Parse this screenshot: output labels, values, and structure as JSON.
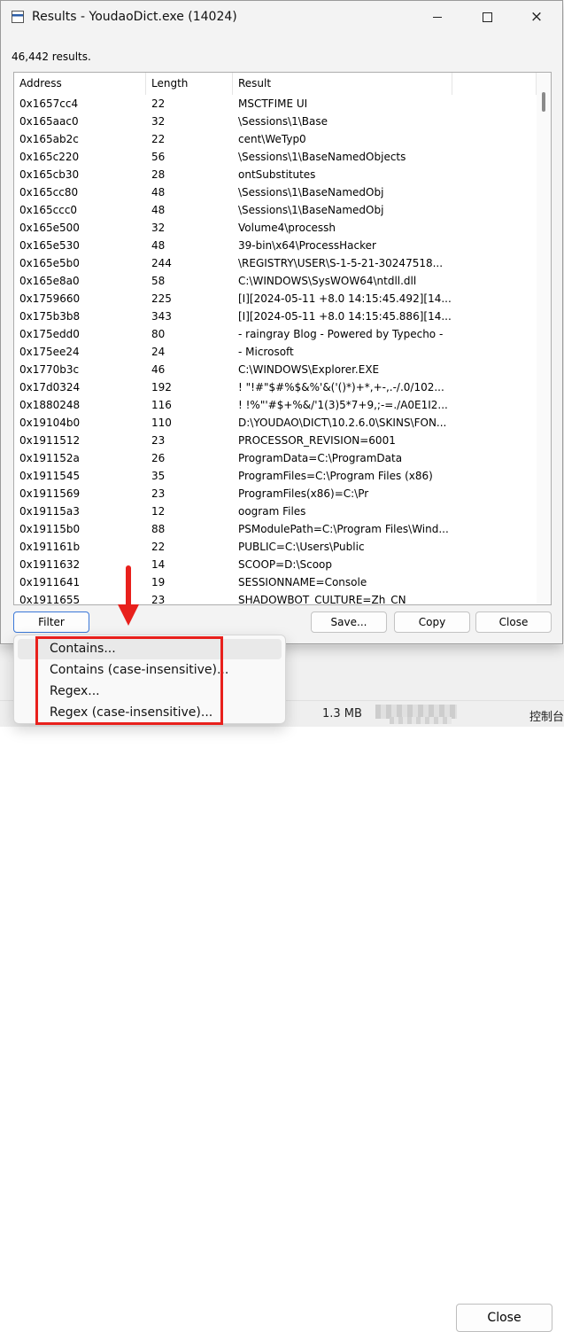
{
  "window": {
    "title": "Results - YoudaoDict.exe (14024)",
    "controls": {
      "minimize": "minimize",
      "maximize": "maximize",
      "close": "×"
    }
  },
  "results_count": "46,442 results.",
  "table": {
    "columns": [
      "Address",
      "Length",
      "Result"
    ],
    "rows": [
      [
        "0x1657cc4",
        "22",
        "MSCTFIME UI"
      ],
      [
        "0x165aac0",
        "32",
        "\\Sessions\\1\\Base"
      ],
      [
        "0x165ab2c",
        "22",
        "cent\\WeTyp0"
      ],
      [
        "0x165c220",
        "56",
        "\\Sessions\\1\\BaseNamedObjects"
      ],
      [
        "0x165cb30",
        "28",
        "ontSubstitutes"
      ],
      [
        "0x165cc80",
        "48",
        "\\Sessions\\1\\BaseNamedObj"
      ],
      [
        "0x165ccc0",
        "48",
        "\\Sessions\\1\\BaseNamedObj"
      ],
      [
        "0x165e500",
        "32",
        "Volume4\\processh"
      ],
      [
        "0x165e530",
        "48",
        "39-bin\\x64\\ProcessHacker"
      ],
      [
        "0x165e5b0",
        "244",
        "\\REGISTRY\\USER\\S-1-5-21-30247518..."
      ],
      [
        "0x165e8a0",
        "58",
        "C:\\WINDOWS\\SysWOW64\\ntdll.dll"
      ],
      [
        "0x1759660",
        "225",
        "[I][2024-05-11 +8.0 14:15:45.492][14..."
      ],
      [
        "0x175b3b8",
        "343",
        "[I][2024-05-11 +8.0 14:15:45.886][14..."
      ],
      [
        "0x175edd0",
        "80",
        " - raingray Blog - Powered by Typecho -"
      ],
      [
        "0x175ee24",
        "24",
        " - Microsoft"
      ],
      [
        "0x1770b3c",
        "46",
        "C:\\WINDOWS\\Explorer.EXE"
      ],
      [
        "0x17d0324",
        "192",
        "! \"!#\"$#%$&%'&('()*)+*,+-,.-/.0/102..."
      ],
      [
        "0x1880248",
        "116",
        "! !%\"'#$+%&/'1(3)5*7+9,;-=./A0E1I2..."
      ],
      [
        "0x19104b0",
        "110",
        "D:\\YOUDAO\\DICT\\10.2.6.0\\SKINS\\FON..."
      ],
      [
        "0x1911512",
        "23",
        "PROCESSOR_REVISION=6001"
      ],
      [
        "0x191152a",
        "26",
        "ProgramData=C:\\ProgramData"
      ],
      [
        "0x1911545",
        "35",
        "ProgramFiles=C:\\Program Files (x86)"
      ],
      [
        "0x1911569",
        "23",
        "ProgramFiles(x86)=C:\\Pr"
      ],
      [
        "0x19115a3",
        "12",
        "oogram Files"
      ],
      [
        "0x19115b0",
        "88",
        "PSModulePath=C:\\Program Files\\Wind..."
      ],
      [
        "0x191161b",
        "22",
        "PUBLIC=C:\\Users\\Public"
      ],
      [
        "0x1911632",
        "14",
        "SCOOP=D:\\Scoop"
      ],
      [
        "0x1911641",
        "19",
        "SESSIONNAME=Console"
      ],
      [
        "0x1911655",
        "23",
        "SHADOWBOT_CULTURE=Zh_CN"
      ]
    ]
  },
  "buttons": {
    "filter": "Filter",
    "save": "Save...",
    "copy": "Copy",
    "close": "Close"
  },
  "filter_menu": {
    "items": [
      "Contains...",
      "Contains (case-insensitive)...",
      "Regex...",
      "Regex (case-insensitive)..."
    ]
  },
  "background_window": {
    "close_button": "Close",
    "status_size": "1.3 MB",
    "status_right": "控制台"
  },
  "colors": {
    "annotation": "#e8201c",
    "focus_border": "#3b78d8"
  }
}
